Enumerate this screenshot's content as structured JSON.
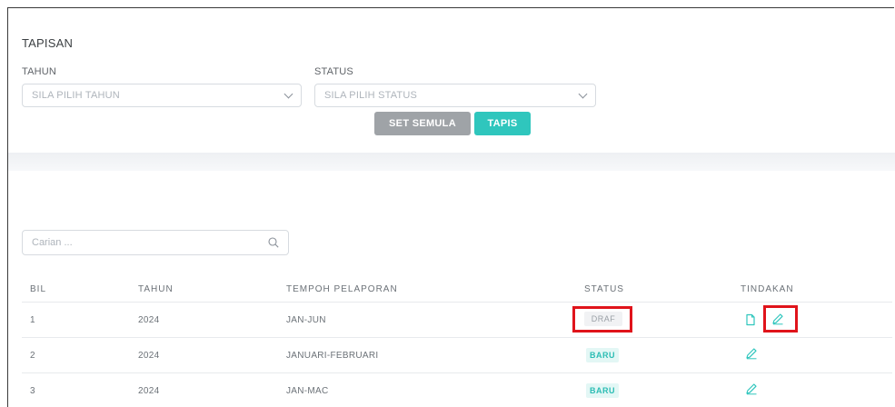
{
  "filter": {
    "title": "TAPISAN",
    "year_label": "TAHUN",
    "year_placeholder": "SILA PILIH TAHUN",
    "status_label": "STATUS",
    "status_placeholder": "SILA PILIH STATUS",
    "reset_label": "SET SEMULA",
    "filter_label": "TAPIS"
  },
  "search": {
    "placeholder": "Carian ..."
  },
  "table": {
    "headers": [
      "BIL",
      "TAHUN",
      "TEMPOH PELAPORAN",
      "STATUS",
      "TINDAKAN"
    ],
    "rows": [
      {
        "bil": "1",
        "tahun": "2024",
        "tempoh": "JAN-JUN",
        "status": "DRAF",
        "actions": [
          "document-icon",
          "edit-icon"
        ]
      },
      {
        "bil": "2",
        "tahun": "2024",
        "tempoh": "JANUARI-FEBRUARI",
        "status": "BARU",
        "actions": [
          "edit-icon"
        ]
      },
      {
        "bil": "3",
        "tahun": "2024",
        "tempoh": "JAN-MAC",
        "status": "BARU",
        "actions": [
          "edit-icon"
        ]
      }
    ]
  },
  "colors": {
    "accent": "#2fc6bd",
    "reset_button": "#9fa3a7",
    "highlight": "#e0141b"
  }
}
